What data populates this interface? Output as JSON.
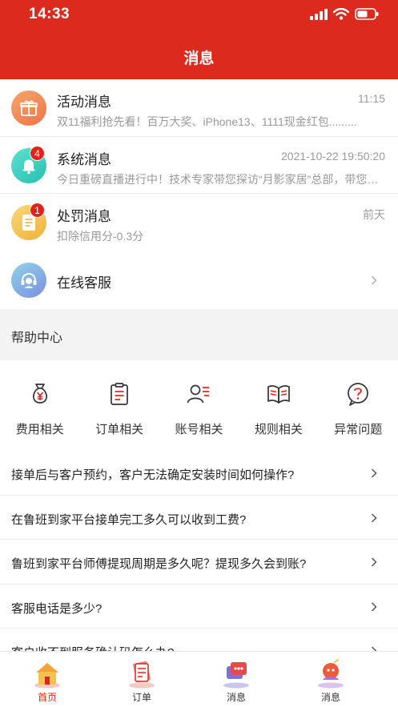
{
  "status_bar": {
    "time": "14:33"
  },
  "header": {
    "title": "消息"
  },
  "messages": [
    {
      "title": "活动消息",
      "time": "11:15",
      "preview": "双11福利抢先看！百万大奖、iPhone13、1111现金红包.........",
      "badge": "",
      "icon": "gift-icon",
      "color": "#f08a5a"
    },
    {
      "title": "系统消息",
      "time": "2021-10-22 19:50:20",
      "preview": "今日重磅直播进行中！技术专家带您探访“月影家居”总部，带您全面了解",
      "badge": "4",
      "icon": "bell-icon",
      "color": "#3fcfbf"
    },
    {
      "title": "处罚消息",
      "time": "前天",
      "preview": "扣除信用分-0.3分",
      "badge": "1",
      "icon": "document-icon",
      "color": "#f3c455"
    }
  ],
  "customer_service": {
    "label": "在线客服",
    "icon": "headset-icon"
  },
  "help_center": {
    "title": "帮助中心",
    "categories": [
      {
        "label": "费用相关",
        "icon": "money-bag-icon"
      },
      {
        "label": "订单相关",
        "icon": "clipboard-icon"
      },
      {
        "label": "账号相关",
        "icon": "user-list-icon"
      },
      {
        "label": "规则相关",
        "icon": "book-icon"
      },
      {
        "label": "异常问题",
        "icon": "question-icon"
      }
    ],
    "faqs": [
      "接单后与客户预约，客户无法确定安装时间如何操作?",
      "在鲁班到家平台接单完工多久可以收到工费?",
      "鲁班到家平台师傅提现周期是多久呢？提现多久会到账?",
      "客服电话是多少?",
      "客户收不到服务确认码怎么办?"
    ]
  },
  "tabbar": [
    {
      "label": "首页",
      "icon": "home-icon",
      "active": true
    },
    {
      "label": "订单",
      "icon": "order-icon",
      "active": false
    },
    {
      "label": "消息",
      "icon": "message-icon",
      "active": false
    },
    {
      "label": "消息",
      "icon": "profile-icon",
      "active": false
    }
  ],
  "colors": {
    "brand_red": "#dc2a1f",
    "section_bg": "#f3f3f3",
    "muted_text": "#999999"
  }
}
